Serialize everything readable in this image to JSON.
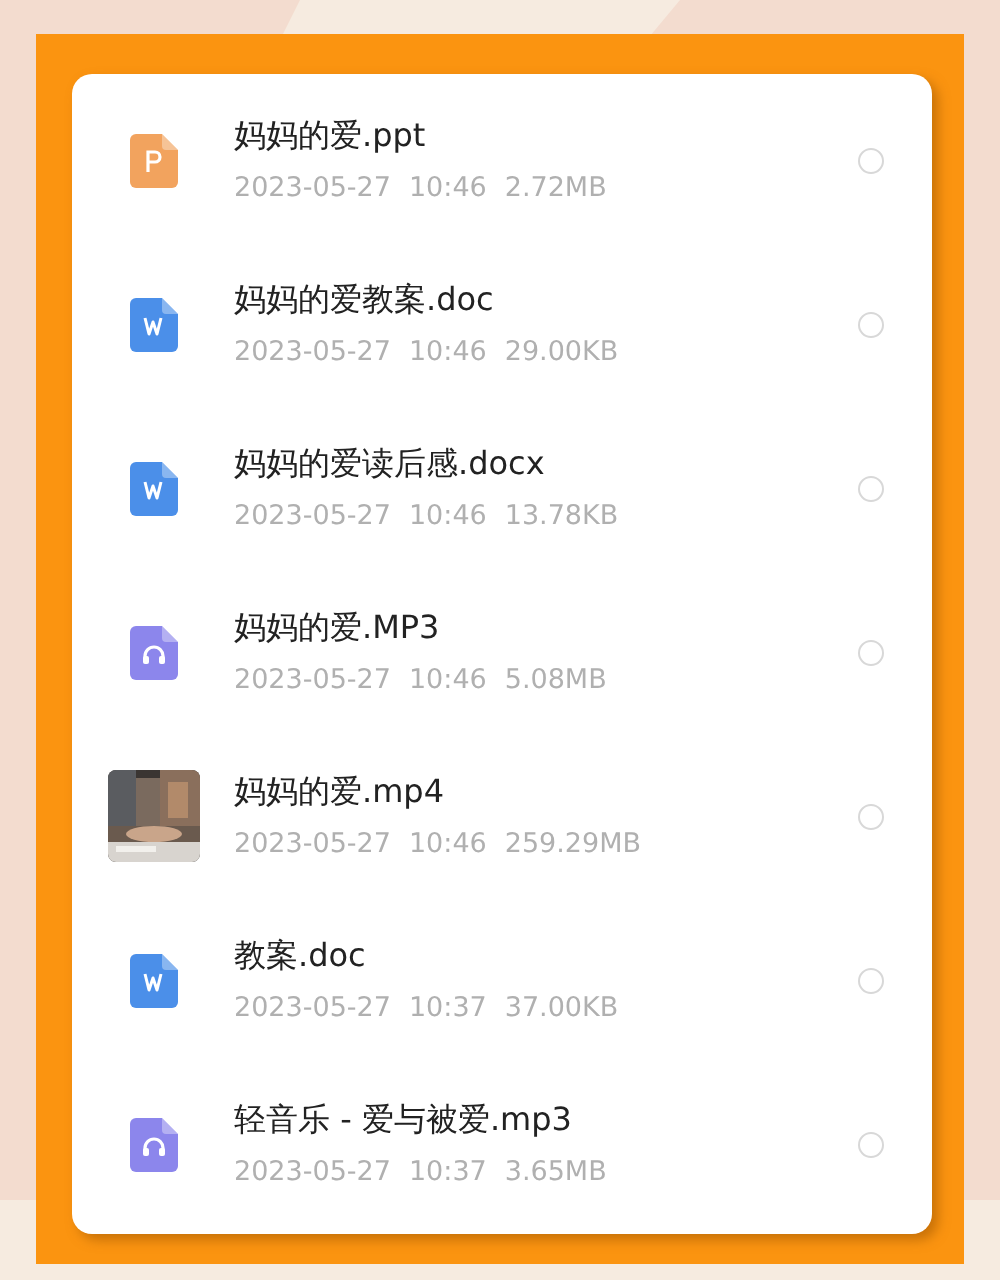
{
  "files": [
    {
      "kind": "ppt",
      "name": "妈妈的爱.ppt",
      "date": "2023-05-27",
      "time": "10:46",
      "size": "2.72MB",
      "selected": false
    },
    {
      "kind": "doc",
      "name": "妈妈的爱教案.doc",
      "date": "2023-05-27",
      "time": "10:46",
      "size": "29.00KB",
      "selected": false
    },
    {
      "kind": "doc",
      "name": "妈妈的爱读后感.docx",
      "date": "2023-05-27",
      "time": "10:46",
      "size": "13.78KB",
      "selected": false
    },
    {
      "kind": "audio",
      "name": "妈妈的爱.MP3",
      "date": "2023-05-27",
      "time": "10:46",
      "size": "5.08MB",
      "selected": false
    },
    {
      "kind": "video",
      "name": "妈妈的爱.mp4",
      "date": "2023-05-27",
      "time": "10:46",
      "size": "259.29MB",
      "selected": false
    },
    {
      "kind": "doc",
      "name": "教案.doc",
      "date": "2023-05-27",
      "time": "10:37",
      "size": "37.00KB",
      "selected": false
    },
    {
      "kind": "audio",
      "name": "轻音乐 - 爱与被爱.mp3",
      "date": "2023-05-27",
      "time": "10:37",
      "size": "3.65MB",
      "selected": false
    }
  ]
}
